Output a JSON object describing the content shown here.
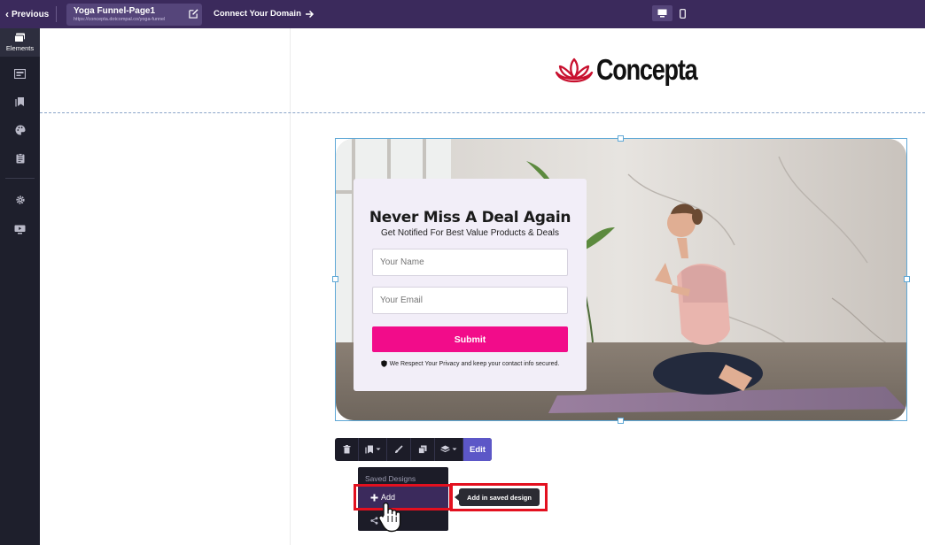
{
  "topbar": {
    "previous_label": "Previous",
    "page_name": "Yoga Funnel-Page1",
    "page_url": "https://concepta.dotcompal.co/yoga-funnel",
    "connect_domain_label": "Connect Your Domain",
    "desktop_icon": "desktop-icon",
    "mobile_icon": "mobile-icon"
  },
  "sidebar": {
    "items": [
      {
        "icon": "elements-icon",
        "label": "Elements"
      },
      {
        "icon": "sections-icon"
      },
      {
        "icon": "saved-blocks-icon"
      },
      {
        "icon": "palette-icon"
      },
      {
        "icon": "clipboard-icon"
      },
      {
        "icon": "gear-icon"
      },
      {
        "icon": "preview-monitor-icon"
      }
    ]
  },
  "logo": {
    "text": "Concepta",
    "color": "#c8102e"
  },
  "form": {
    "title": "Never Miss A Deal Again",
    "subtitle": "Get Notified For Best Value Products & Deals",
    "name_placeholder": "Your Name",
    "email_placeholder": "Your Email",
    "submit_label": "Submit",
    "privacy_text": "We Respect Your Privacy and keep your contact info secured.",
    "accent": "#f20c8a"
  },
  "toolbar": {
    "edit_label": "Edit"
  },
  "saved_designs_menu": {
    "header": "Saved Designs",
    "add_label": "Add",
    "tooltip": "Add in saved design"
  },
  "colors": {
    "topbar": "#3b2a5c",
    "sidebar": "#1e1f2c",
    "highlight": "#e3101f",
    "edit_button": "#5c57c7"
  }
}
